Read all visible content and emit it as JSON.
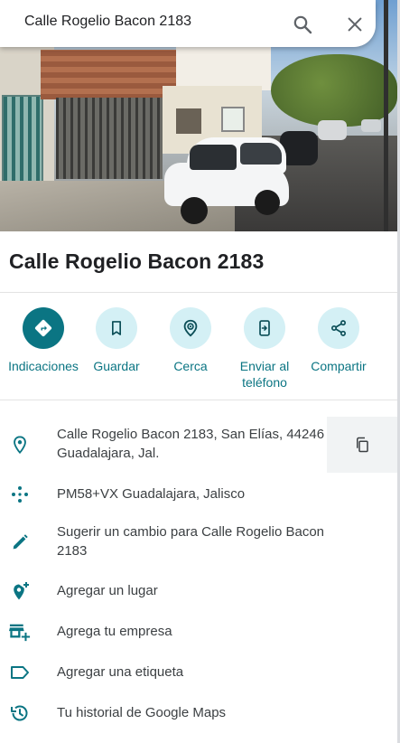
{
  "search": {
    "query": "Calle Rogelio Bacon 2183"
  },
  "place": {
    "title": "Calle Rogelio Bacon 2183"
  },
  "actions": [
    {
      "label": "Indicaciones",
      "icon": "directions-icon"
    },
    {
      "label": "Guardar",
      "icon": "bookmark-icon"
    },
    {
      "label": "Cerca",
      "icon": "nearby-icon"
    },
    {
      "label": "Enviar al teléfono",
      "icon": "send-to-phone-icon"
    },
    {
      "label": "Compartir",
      "icon": "share-icon"
    }
  ],
  "info": {
    "address_line1": "Calle Rogelio Bacon 2183, San Elías, 44246",
    "address_line2": "Guadalajara, Jal.",
    "plus_code": "PM58+VX Guadalajara, Jalisco",
    "suggest_line1": "Sugerir un cambio para Calle Rogelio Bacon",
    "suggest_line2": "2183",
    "add_place": "Agregar un lugar",
    "add_business": "Agrega tu empresa",
    "add_label": "Agregar una etiqueta",
    "history": "Tu historial de Google Maps"
  },
  "colors": {
    "accent": "#0b7583",
    "accent_light": "#d4f0f5",
    "text": "#202124",
    "secondary_text": "#3c4043"
  }
}
